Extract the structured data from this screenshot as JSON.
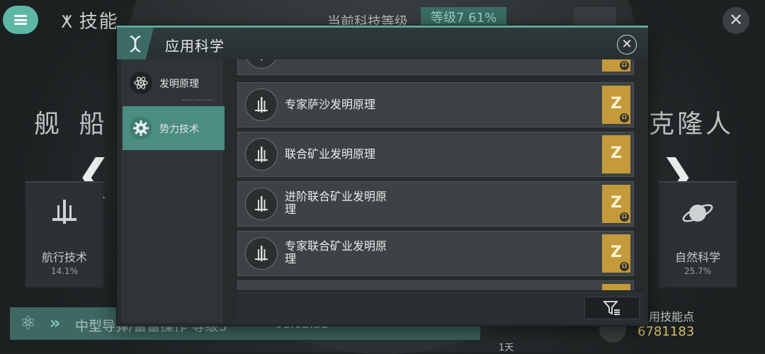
{
  "background": {
    "screen_title": "技能",
    "tech_level_label": "当前科技等级",
    "tech_level_value": "等级7  61%",
    "left_big_label": "舰 船",
    "right_big_label": "克隆人",
    "left_card": {
      "name": "航行技术",
      "percent": "14.1%",
      "icon": "ship-icon"
    },
    "right_card": {
      "name": "自然科学",
      "percent": "25.7%",
      "icon": "planet-icon"
    },
    "research_text": "中型导弹/雷雷操作 等级3",
    "research_timer": "01:02:32",
    "duration_label": "1天",
    "skill_points_label": "可用技能点",
    "skill_points_value": "6781183"
  },
  "modal": {
    "title": "应用科学",
    "close_icon": "close-icon",
    "tabs": [
      {
        "label": "发明原理",
        "icon": "atom-icon",
        "selected": false
      },
      {
        "label": "势力技术",
        "icon": "gear-icon",
        "selected": true
      }
    ],
    "items": [
      {
        "name": "",
        "badge": "Z",
        "omega": "Ω"
      },
      {
        "name": "专家萨沙发明原理",
        "badge": "Z",
        "omega": "Ω"
      },
      {
        "name": "联合矿业发明原理",
        "badge": "Z",
        "omega": ""
      },
      {
        "name": "进阶联合矿业发明原理",
        "badge": "Z",
        "omega": "Ω"
      },
      {
        "name": "专家联合矿业发明原理",
        "badge": "Z",
        "omega": "Ω"
      },
      {
        "name": "",
        "badge": "",
        "omega": ""
      }
    ],
    "filter_icon": "filter-icon"
  },
  "colors": {
    "accent": "#5fb7a6",
    "selected_tab": "#4b8d80",
    "badge_gold": "#c49a3c"
  }
}
